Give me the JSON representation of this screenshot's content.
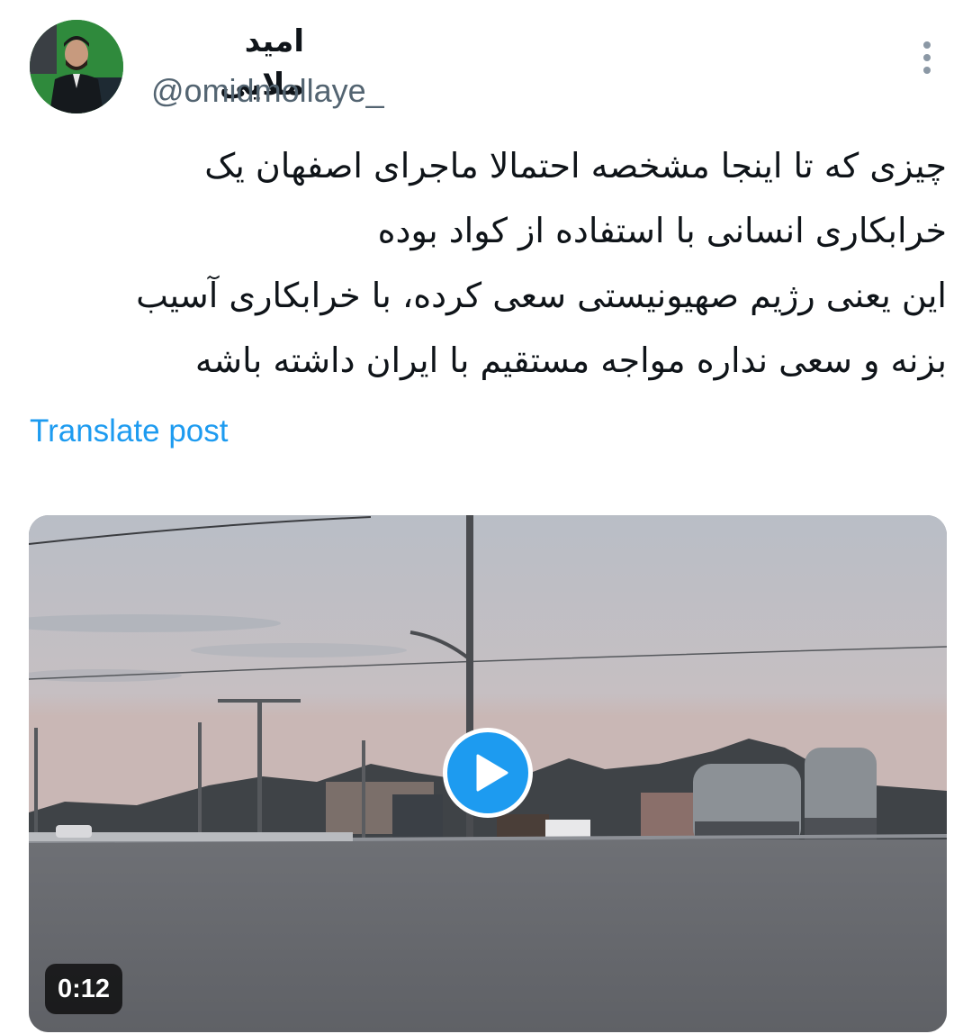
{
  "author": {
    "display_name": "امید ملایی",
    "handle": "@omidmollaye_"
  },
  "post": {
    "lines": [
      "چیزی که تا اینجا مشخصه احتمالا ماجرای اصفهان یک",
      "خرابکاری انسانی با استفاده از کواد بوده",
      "این یعنی رژیم صهیونیستی سعی کرده، با خرابکاری آسیب",
      "بزنه و سعی نداره مواجه مستقیم با ایران داشته باشه"
    ],
    "translate_label": "Translate post"
  },
  "media": {
    "type": "video",
    "duration": "0:12"
  },
  "icons": {
    "more": "more-vertical-icon",
    "play": "play-icon"
  },
  "colors": {
    "link": "#1d9bf0",
    "play_button": "#1d9bf0",
    "handle": "#536471"
  }
}
